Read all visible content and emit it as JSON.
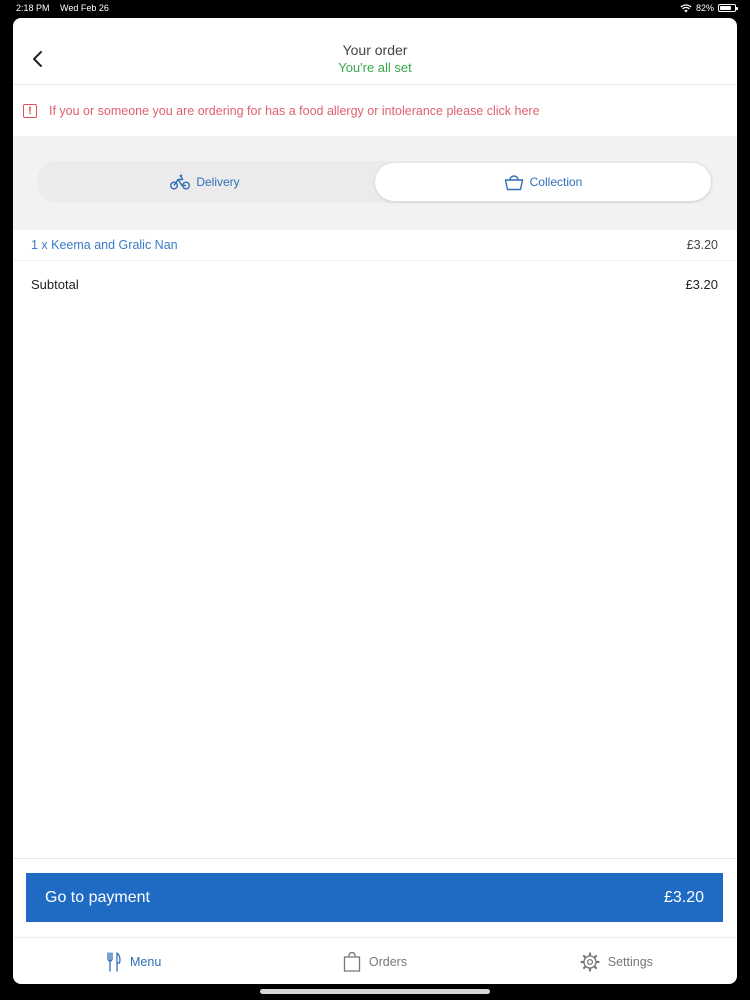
{
  "status_bar": {
    "time": "2:18 PM",
    "date": "Wed Feb 26",
    "battery": "82%",
    "battery_level": 0.82
  },
  "header": {
    "title": "Your order",
    "subtitle": "You're all set",
    "back_icon": "chevron-left-icon"
  },
  "allergy_notice": {
    "text": "If you or someone you are ordering for has a food allergy or intolerance please click here",
    "icon": "warning-icon",
    "color": "#e0505d"
  },
  "fulfilment_tabs": [
    {
      "label": "Delivery",
      "icon": "bicycle-icon",
      "active": false
    },
    {
      "label": "Collection",
      "icon": "basket-icon",
      "active": true
    }
  ],
  "order_items": [
    {
      "label": "1 x Keema and Gralic Nan",
      "price": "£3.20"
    }
  ],
  "subtotal": {
    "label": "Subtotal",
    "value": "£3.20"
  },
  "payment_button": {
    "label": "Go to payment",
    "amount": "£3.20",
    "color": "#1f6bc4"
  },
  "tab_bar": [
    {
      "label": "Menu",
      "icon": "fork-knife-icon",
      "active": true
    },
    {
      "label": "Orders",
      "icon": "shopping-bag-icon",
      "active": false
    },
    {
      "label": "Settings",
      "icon": "gear-icon",
      "active": false
    }
  ]
}
